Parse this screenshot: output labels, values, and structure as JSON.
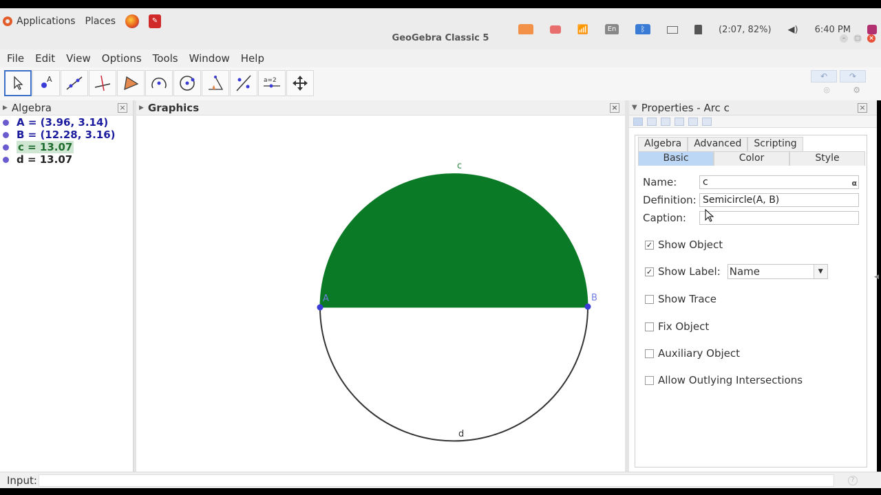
{
  "system_panel": {
    "applications_label": "Applications",
    "places_label": "Places",
    "keyboard_layout": "En",
    "battery_status": "(2:07, 82%)",
    "clock": "6:40 PM"
  },
  "window": {
    "title": "GeoGebra Classic 5"
  },
  "menu": {
    "items": [
      "File",
      "Edit",
      "View",
      "Options",
      "Tools",
      "Window",
      "Help"
    ]
  },
  "toolbar": {
    "tools": [
      {
        "icon": "move-tool-icon",
        "active": true
      },
      {
        "icon": "point-tool-icon"
      },
      {
        "icon": "line-tool-icon"
      },
      {
        "icon": "perpendicular-line-tool-icon"
      },
      {
        "icon": "polygon-tool-icon"
      },
      {
        "icon": "circle-tool-icon"
      },
      {
        "icon": "ellipse-tool-icon"
      },
      {
        "icon": "angle-tool-icon"
      },
      {
        "icon": "reflect-tool-icon"
      },
      {
        "icon": "slider-tool-icon",
        "text": "a=2"
      },
      {
        "icon": "move-graphics-view-icon"
      }
    ]
  },
  "algebra": {
    "title": "Algebra",
    "items": [
      {
        "text": "A = (3.96, 3.14)"
      },
      {
        "text": "B = (12.28, 3.16)"
      },
      {
        "text": "c = 13.07",
        "selected": true
      },
      {
        "text": "d = 13.07"
      }
    ]
  },
  "graphics": {
    "title": "Graphics",
    "labels": {
      "A": "A",
      "B": "B",
      "c": "c",
      "d": "d"
    },
    "semicircle_fill": "#0b7a26",
    "point_color": "#3b3bd6"
  },
  "properties": {
    "title": "Properties - Arc c",
    "tabs_row1": [
      "Algebra",
      "Advanced",
      "Scripting"
    ],
    "tabs_row2": [
      "Basic",
      "Color",
      "Style"
    ],
    "selected_tab": "Basic",
    "name_label": "Name:",
    "name_value": "c",
    "alpha_symbol": "α",
    "definition_label": "Definition:",
    "definition_value": "Semicircle(A, B)",
    "caption_label": "Caption:",
    "caption_value": "",
    "checkboxes": {
      "show_object": {
        "label": "Show Object",
        "checked": true
      },
      "show_label": {
        "label": "Show Label:",
        "checked": true
      },
      "show_trace": {
        "label": "Show Trace",
        "checked": false
      },
      "fix_object": {
        "label": "Fix Object",
        "checked": false
      },
      "auxiliary_object": {
        "label": "Auxiliary Object",
        "checked": false
      },
      "allow_outlying": {
        "label": "Allow Outlying Intersections",
        "checked": false
      }
    },
    "label_mode": "Name"
  },
  "input_bar": {
    "label": "Input:",
    "value": ""
  }
}
